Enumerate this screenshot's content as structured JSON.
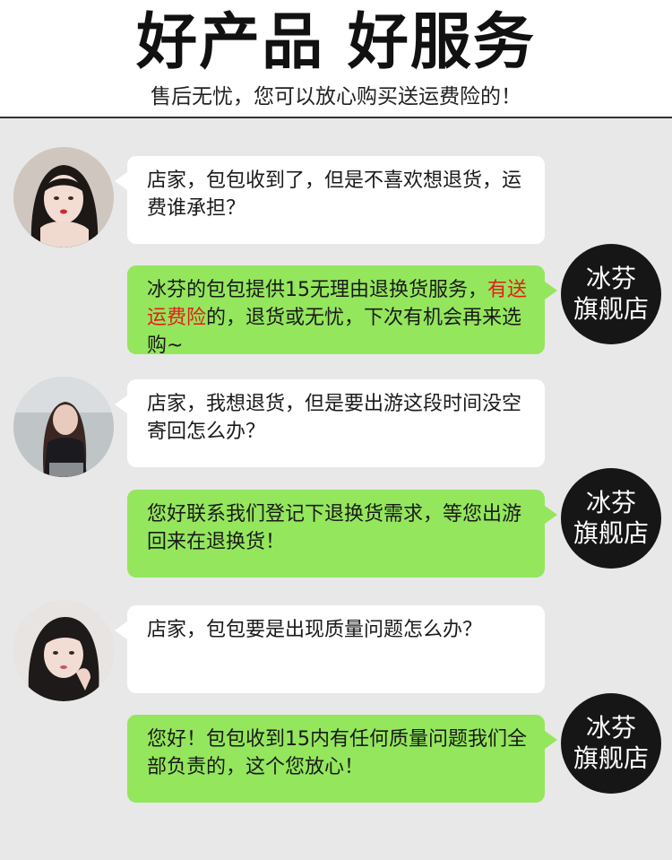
{
  "header": {
    "title": "好产品 好服务",
    "subtitle": "售后无忧，您可以放心购买送运费险的！"
  },
  "store_badge": {
    "line1": "冰芬",
    "line2": "旗舰店"
  },
  "conversation": [
    {
      "customer": "店家，包包收到了，但是不喜欢想退货，运费谁承担？",
      "reply_parts": [
        "冰芬的包包提供15无理由退换货服务，",
        "有送运费险",
        "的，退货或无忧，下次有机会再来选购~"
      ]
    },
    {
      "customer": "店家，我想退货，但是要出游这段时间没空寄回怎么办？",
      "reply": "您好联系我们登记下退换货需求，等您出游回来在退换货！"
    },
    {
      "customer": "店家，包包要是出现质量问题怎么办？",
      "reply": "您好！包包收到15内有任何质量问题我们全部负责的，这个您放心！"
    }
  ],
  "colors": {
    "reply_bubble": "#94e65c",
    "customer_bubble": "#ffffff",
    "badge": "#161616",
    "highlight": "#e61c1c",
    "chat_background": "#e8e8e8"
  }
}
